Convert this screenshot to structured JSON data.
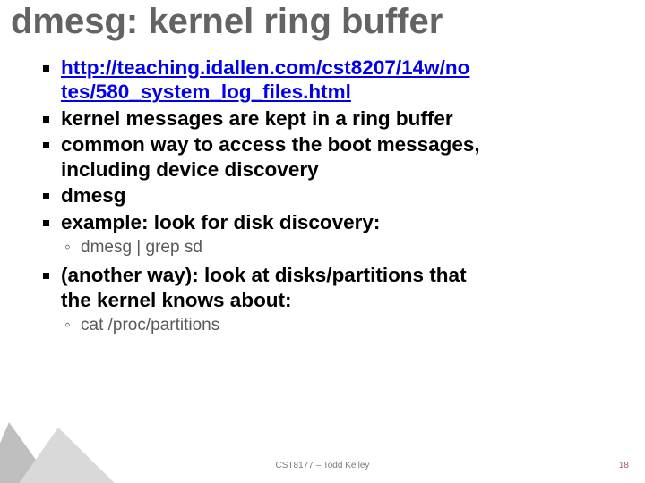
{
  "title": "dmesg: kernel ring buffer",
  "bullets": {
    "b1_link_line1": "http://teaching.idallen.com/cst8207/14w/no",
    "b1_link_line2": "tes/580_system_log_files.html",
    "b1_href": "http://teaching.idallen.com/cst8207/14w/notes/580_system_log_files.html",
    "b2": "kernel messages are kept in a ring buffer",
    "b3a": "common way to access the boot messages,",
    "b3b": "including device discovery",
    "b4": "dmesg",
    "b5": "example: look for disk discovery:",
    "b5_sub": "dmesg | grep sd",
    "b6a": "(another way): look at disks/partitions that",
    "b6b": "the kernel knows about:",
    "b6_sub": "cat /proc/partitions"
  },
  "footer": {
    "center": "CST8177 – Todd Kelley",
    "page": "18"
  }
}
